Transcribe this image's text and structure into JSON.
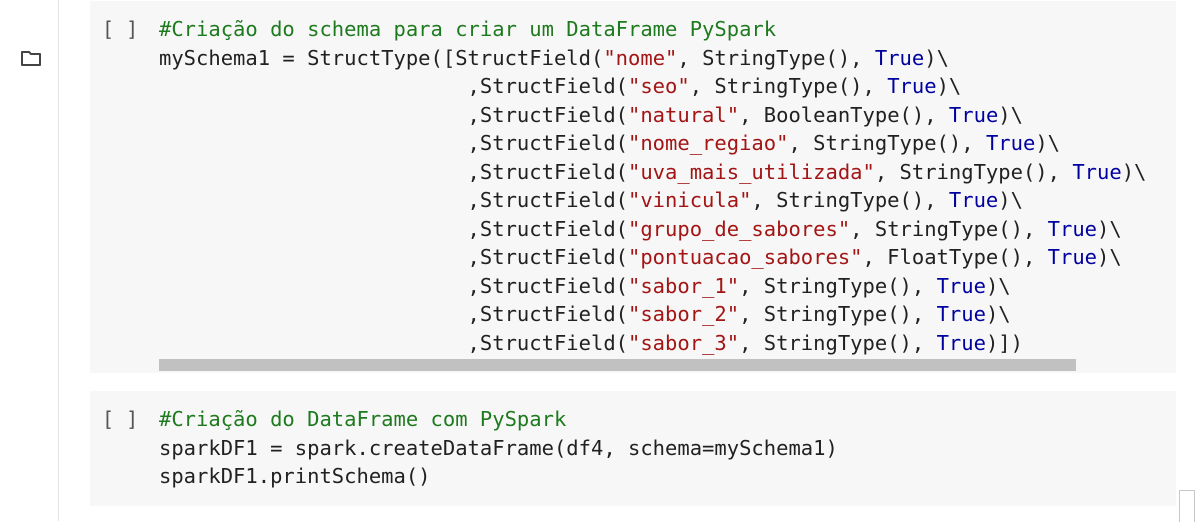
{
  "sidebar": {
    "icons": [
      "folder-icon"
    ]
  },
  "cells": [
    {
      "run_indicator": "[ ]",
      "lines": [
        [
          {
            "t": "cm",
            "v": "#Criação do schema para criar um DataFrame PySpark"
          }
        ],
        [
          {
            "t": "p",
            "v": "mySchema1 = StructType([StructField("
          },
          {
            "t": "st",
            "v": "\"nome\""
          },
          {
            "t": "p",
            "v": ", StringType(), "
          },
          {
            "t": "kw",
            "v": "True"
          },
          {
            "t": "p",
            "v": ")\\"
          }
        ],
        [
          {
            "t": "p",
            "v": "                         ,StructField("
          },
          {
            "t": "st",
            "v": "\"seo\""
          },
          {
            "t": "p",
            "v": ", StringType(), "
          },
          {
            "t": "kw",
            "v": "True"
          },
          {
            "t": "p",
            "v": ")\\"
          }
        ],
        [
          {
            "t": "p",
            "v": "                         ,StructField("
          },
          {
            "t": "st",
            "v": "\"natural\""
          },
          {
            "t": "p",
            "v": ", BooleanType(), "
          },
          {
            "t": "kw",
            "v": "True"
          },
          {
            "t": "p",
            "v": ")\\"
          }
        ],
        [
          {
            "t": "p",
            "v": "                         ,StructField("
          },
          {
            "t": "st",
            "v": "\"nome_regiao\""
          },
          {
            "t": "p",
            "v": ", StringType(), "
          },
          {
            "t": "kw",
            "v": "True"
          },
          {
            "t": "p",
            "v": ")\\"
          }
        ],
        [
          {
            "t": "p",
            "v": "                         ,StructField("
          },
          {
            "t": "st",
            "v": "\"uva_mais_utilizada\""
          },
          {
            "t": "p",
            "v": ", StringType(), "
          },
          {
            "t": "kw",
            "v": "True"
          },
          {
            "t": "p",
            "v": ")\\"
          }
        ],
        [
          {
            "t": "p",
            "v": "                         ,StructField("
          },
          {
            "t": "st",
            "v": "\"vinicula\""
          },
          {
            "t": "p",
            "v": ", StringType(), "
          },
          {
            "t": "kw",
            "v": "True"
          },
          {
            "t": "p",
            "v": ")\\"
          }
        ],
        [
          {
            "t": "p",
            "v": "                         ,StructField("
          },
          {
            "t": "st",
            "v": "\"grupo_de_sabores\""
          },
          {
            "t": "p",
            "v": ", StringType(), "
          },
          {
            "t": "kw",
            "v": "True"
          },
          {
            "t": "p",
            "v": ")\\"
          }
        ],
        [
          {
            "t": "p",
            "v": "                         ,StructField("
          },
          {
            "t": "st",
            "v": "\"pontuacao_sabores\""
          },
          {
            "t": "p",
            "v": ", FloatType(), "
          },
          {
            "t": "kw",
            "v": "True"
          },
          {
            "t": "p",
            "v": ")\\"
          }
        ],
        [
          {
            "t": "p",
            "v": "                         ,StructField("
          },
          {
            "t": "st",
            "v": "\"sabor_1\""
          },
          {
            "t": "p",
            "v": ", StringType(), "
          },
          {
            "t": "kw",
            "v": "True"
          },
          {
            "t": "p",
            "v": ")\\"
          }
        ],
        [
          {
            "t": "p",
            "v": "                         ,StructField("
          },
          {
            "t": "st",
            "v": "\"sabor_2\""
          },
          {
            "t": "p",
            "v": ", StringType(), "
          },
          {
            "t": "kw",
            "v": "True"
          },
          {
            "t": "p",
            "v": ")\\"
          }
        ],
        [
          {
            "t": "p",
            "v": "                         ,StructField("
          },
          {
            "t": "st",
            "v": "\"sabor_3\""
          },
          {
            "t": "p",
            "v": ", StringType(), "
          },
          {
            "t": "kw",
            "v": "True"
          },
          {
            "t": "p",
            "v": ")])"
          }
        ]
      ]
    },
    {
      "run_indicator": "[ ]",
      "lines": [
        [
          {
            "t": "cm",
            "v": "#Criação do DataFrame com PySpark"
          }
        ],
        [
          {
            "t": "p",
            "v": "sparkDF1 = spark.createDataFrame(df4, schema=mySchema1)"
          }
        ],
        [
          {
            "t": "p",
            "v": "sparkDF1.printSchema()"
          }
        ]
      ]
    }
  ],
  "colors": {
    "comment": "#1e7a1e",
    "string": "#a31515",
    "keyword": "#0000a0",
    "plain": "#212121",
    "cell_bg": "#f7f7f7"
  }
}
